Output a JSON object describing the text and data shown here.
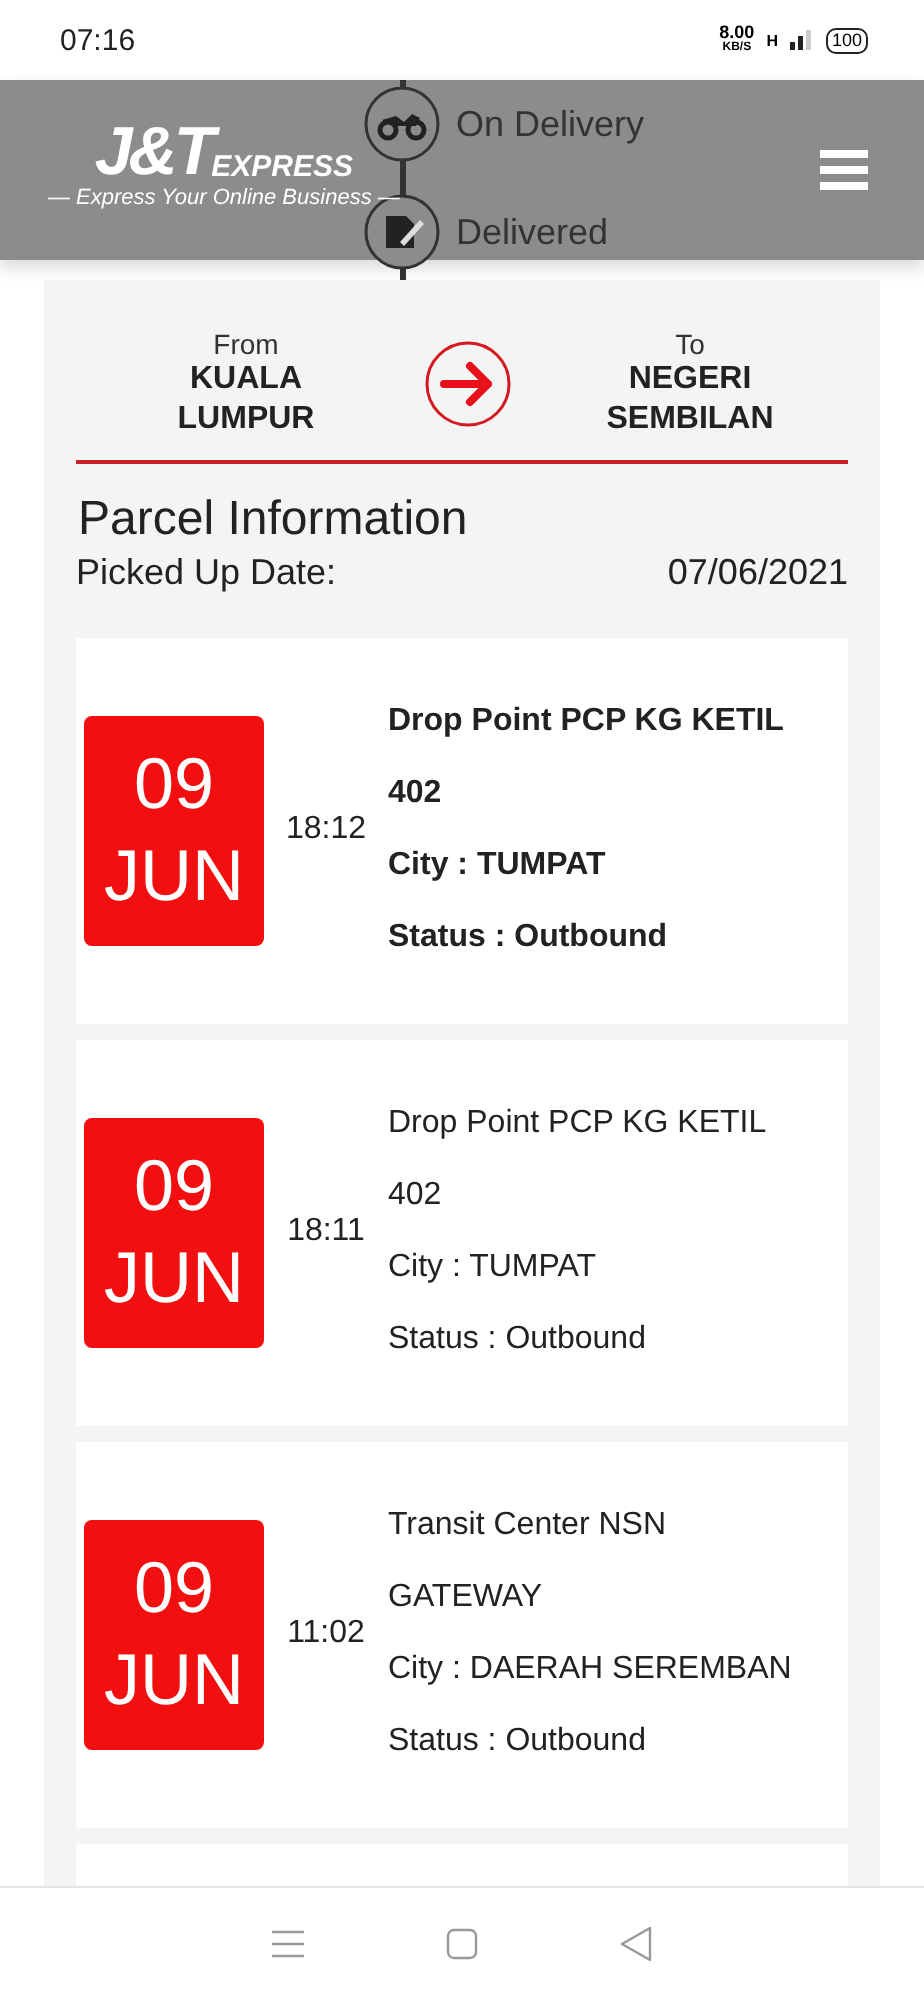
{
  "status_bar": {
    "time": "07:16",
    "speed": "8.00",
    "speed_unit": "KB/S",
    "network": "H",
    "battery": "100"
  },
  "header": {
    "logo": "J&T",
    "logo_suffix": "EXPRESS",
    "tagline": "— Express Your Online Business —"
  },
  "timeline": [
    {
      "label": "On Delivery",
      "kind": "motorbike"
    },
    {
      "label": "Delivered",
      "kind": "signature"
    }
  ],
  "route": {
    "from_label": "From",
    "from": "KUALA\nLUMPUR",
    "to_label": "To",
    "to": "NEGERI\nSEMBILAN"
  },
  "parcel": {
    "title": "Parcel Information",
    "picked_label": "Picked Up Date:",
    "picked_date": "07/06/2021"
  },
  "events": [
    {
      "day": "09",
      "month": "JUN",
      "time": "18:12",
      "location": "Drop Point PCP KG KETIL 402",
      "city": "City : TUMPAT",
      "status": "Status : Outbound",
      "latest": true
    },
    {
      "day": "09",
      "month": "JUN",
      "time": "18:11",
      "location": "Drop Point PCP KG KETIL 402",
      "city": "City : TUMPAT",
      "status": "Status : Outbound",
      "latest": false
    },
    {
      "day": "09",
      "month": "JUN",
      "time": "11:02",
      "location": "Transit Center NSN GATEWAY",
      "city": "City : DAERAH SEREMBAN",
      "status": "Status : Outbound",
      "latest": false
    }
  ]
}
